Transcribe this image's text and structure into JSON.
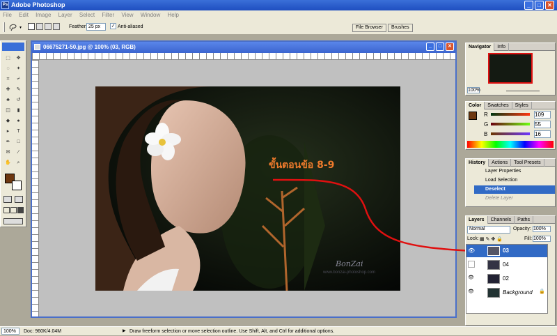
{
  "app": {
    "title": "Adobe Photoshop",
    "icon_label": "Ps"
  },
  "menu": [
    "File",
    "Edit",
    "Image",
    "Layer",
    "Select",
    "Filter",
    "View",
    "Window",
    "Help"
  ],
  "options": {
    "feather_label": "Feather:",
    "feather_value": "25 px",
    "antialiased_label": "Anti-aliased",
    "antialiased_checked": true,
    "well_tabs": [
      "File Browser",
      "Brushes"
    ]
  },
  "document": {
    "title": "06675271-50.jpg @ 100% (03, RGB)"
  },
  "canvas": {
    "overlay_text": "ขั้นตอนข้อ 8-9",
    "watermark": "BonZai",
    "watermark_sub": "www.bonzai-photoshop.com"
  },
  "navigator": {
    "tabs": [
      "Navigator",
      "Info"
    ],
    "zoom": "100%"
  },
  "color": {
    "tabs": [
      "Color",
      "Swatches",
      "Styles"
    ],
    "r": "109",
    "g": "55",
    "b": "16",
    "r_label": "R",
    "g_label": "G",
    "b_label": "B",
    "foreground": "#6d3710"
  },
  "history": {
    "tabs": [
      "History",
      "Actions",
      "Tool Presets"
    ],
    "items": [
      "Layer Properties",
      "Load Selection",
      "Deselect",
      "Delete Layer"
    ],
    "active_index": 2
  },
  "layers": {
    "tabs": [
      "Layers",
      "Channels",
      "Paths"
    ],
    "blend_mode": "Normal",
    "opacity_label": "Opacity:",
    "opacity": "100%",
    "lock_label": "Lock:",
    "fill_label": "Fill:",
    "fill": "100%",
    "items": [
      {
        "name": "03",
        "selected": true
      },
      {
        "name": "04",
        "selected": false
      },
      {
        "name": "02",
        "selected": false
      },
      {
        "name": "Background",
        "selected": false
      }
    ]
  },
  "status": {
    "zoom": "100%",
    "doc": "Doc: 960K/4.04M",
    "hint": "Draw freeform selection or move selection outline. Use Shift, Alt, and Ctrl for additional options."
  },
  "colors": {
    "accent": "#316ac5",
    "arrow": "#e01010",
    "overlay_text": "#ee7a2c",
    "titlebar": "#1f4fc0"
  }
}
